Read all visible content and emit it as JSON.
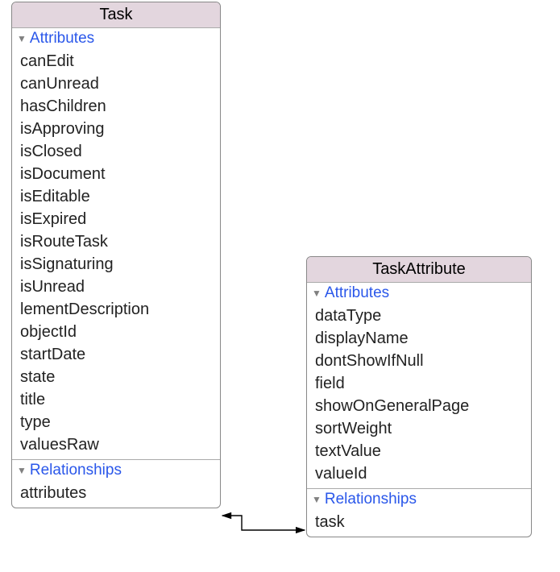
{
  "entities": {
    "task": {
      "title": "Task",
      "attributesHeader": "Attributes",
      "attributes": [
        "canEdit",
        "canUnread",
        "hasChildren",
        "isApproving",
        "isClosed",
        "isDocument",
        "isEditable",
        "isExpired",
        "isRouteTask",
        "isSignaturing",
        "isUnread",
        "lementDescription",
        "objectId",
        "startDate",
        "state",
        "title",
        "type",
        "valuesRaw"
      ],
      "relationshipsHeader": "Relationships",
      "relationships": [
        "attributes"
      ]
    },
    "taskAttribute": {
      "title": "TaskAttribute",
      "attributesHeader": "Attributes",
      "attributes": [
        "dataType",
        "displayName",
        "dontShowIfNull",
        "field",
        "showOnGeneralPage",
        "sortWeight",
        "textValue",
        "valueId"
      ],
      "relationshipsHeader": "Relationships",
      "relationships": [
        "task"
      ]
    }
  },
  "relationshipConnector": {
    "from": "task.attributes",
    "to": "taskAttribute.task",
    "type": "bidirectional"
  }
}
